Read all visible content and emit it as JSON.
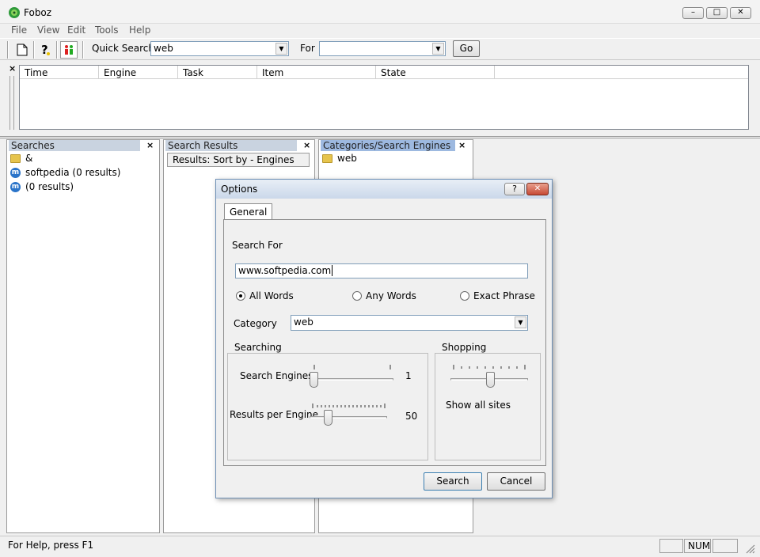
{
  "window": {
    "title": "Foboz",
    "minimize": "–",
    "maximize": "□",
    "close": "✕"
  },
  "menu": [
    "File",
    "View",
    "Edit",
    "Tools",
    "Help"
  ],
  "toolbar": {
    "quick_search_label": "Quick Search",
    "quick_search_value": "web",
    "for_label": "For",
    "for_value": "",
    "go_label": "Go"
  },
  "tasklist": {
    "columns": [
      "Time",
      "Engine",
      "Task",
      "Item",
      "State"
    ],
    "close": "×"
  },
  "searches": {
    "title": "Searches",
    "items": [
      {
        "icon": "folder-icon",
        "label": "&"
      },
      {
        "icon": "engine-icon",
        "label": "softpedia (0 results)"
      },
      {
        "icon": "engine-icon",
        "label": " (0 results)"
      }
    ]
  },
  "results": {
    "title": "Search Results",
    "sort_label": "Results: Sort by - Engines"
  },
  "categories": {
    "title": "Categories/Search Engines",
    "items": [
      {
        "icon": "folder-icon",
        "label": "web"
      }
    ]
  },
  "pane_close": "×",
  "statusbar": {
    "help_text": "For Help, press F1",
    "num": "NUM"
  },
  "dialog": {
    "title": "Options",
    "help": "?",
    "close": "✕",
    "tab": "General",
    "search_for_label": "Search For",
    "search_for_value": "www.softpedia.com",
    "radio_all": "All Words",
    "radio_any": "Any Words",
    "radio_exact": "Exact Phrase",
    "selected_mode": "All Words",
    "category_label": "Category",
    "category_value": "web",
    "searching_group": "Searching",
    "search_engines_label": "Search Engines",
    "search_engines_value": "1",
    "results_per_engine_label": "Results per Engine",
    "results_per_engine_value": "50",
    "shopping_group": "Shopping",
    "shopping_label": "Show all sites",
    "search_button": "Search",
    "cancel_button": "Cancel"
  },
  "colors": {
    "pane_header": "#c9d3e0",
    "pane_header_active": "#9db9e0",
    "folder": "#e6c44d",
    "engine": "#2a74c9"
  }
}
